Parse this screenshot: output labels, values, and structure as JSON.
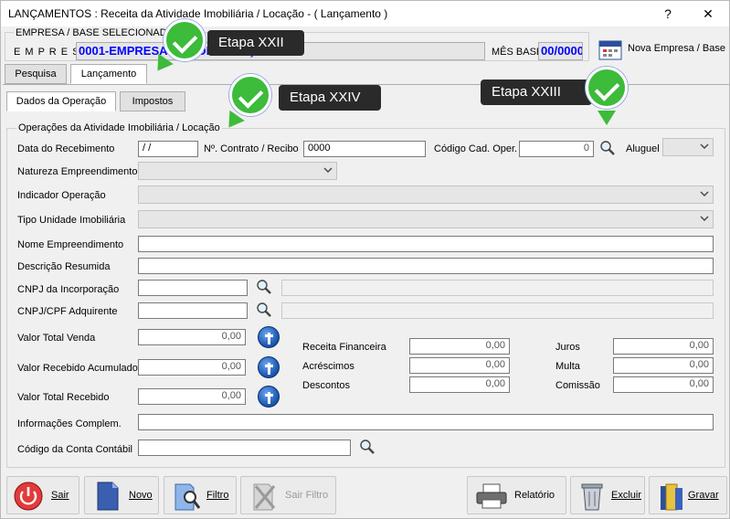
{
  "window": {
    "title": "LANÇAMENTOS : Receita da Atividade Imobiliária / Locação - ( Lançamento )",
    "help": "?",
    "close": "✕"
  },
  "header": {
    "empresa_group_label": "EMPRESA / BASE SELECIONADA",
    "empresa_label": "E M P R E S A",
    "empresa_value": "0001-EMPRESA DEMONSTRAÇÃO",
    "mes_base_label": "MÊS BASE",
    "mes_base_value": "00/0000",
    "nova_empresa_label": "Nova Empresa / Base"
  },
  "tabs": {
    "pesquisa": "Pesquisa",
    "lancamento": "Lançamento"
  },
  "subtabs": {
    "dados": "Dados da Operação",
    "impostos": "Impostos"
  },
  "group_title": "Operações da Atividade Imobiliária / Locação",
  "form": {
    "data_recebimento_label": "Data do Recebimento",
    "data_recebimento_value": " / /",
    "contrato_label": "Nº. Contrato / Recibo",
    "contrato_value": "0000",
    "codigo_cad_label": "Código Cad. Oper.",
    "codigo_cad_value": "0",
    "aluguel_label": "Aluguel",
    "natureza_label": "Natureza Empreendimento",
    "indicador_label": "Indicador Operação",
    "tipo_unidade_label": "Tipo Unidade Imobiliária",
    "nome_empreendimento_label": "Nome Empreendimento",
    "descricao_label": "Descrição Resumida",
    "cnpj_incorporacao_label": "CNPJ da Incorporação",
    "cnpj_adquirente_label": "CNPJ/CPF Adquirente",
    "valor_total_venda_label": "Valor Total Venda",
    "valor_total_venda_value": "0,00",
    "valor_recebido_acum_label": "Valor Recebido Acumulado",
    "valor_recebido_acum_value": "0,00",
    "valor_total_recebido_label": "Valor Total Recebido",
    "valor_total_recebido_value": "0,00",
    "receita_fin_label": "Receita Financeira",
    "receita_fin_value": "0,00",
    "acrescimos_label": "Acréscimos",
    "acrescimos_value": "0,00",
    "descontos_label": "Descontos",
    "descontos_value": "0,00",
    "juros_label": "Juros",
    "juros_value": "0,00",
    "multa_label": "Multa",
    "multa_value": "0,00",
    "comissao_label": "Comissão",
    "comissao_value": "0,00",
    "info_label": "Informações Complem.",
    "conta_contabil_label": "Código da Conta Contábil"
  },
  "buttons": {
    "sair": "Sair",
    "novo": "Novo",
    "filtro": "Filtro",
    "sair_filtro": "Sair Filtro",
    "relatorio": "Relatório",
    "excluir": "Excluir",
    "gravar": "Gravar"
  },
  "callouts": {
    "etapa22": "Etapa XXII",
    "etapa23": "Etapa XXIII",
    "etapa24": "Etapa XXIV"
  },
  "colors": {
    "accent_blue": "#0000ff",
    "check_green": "#3dbb3a",
    "callout_bg": "#2a2a2a"
  }
}
